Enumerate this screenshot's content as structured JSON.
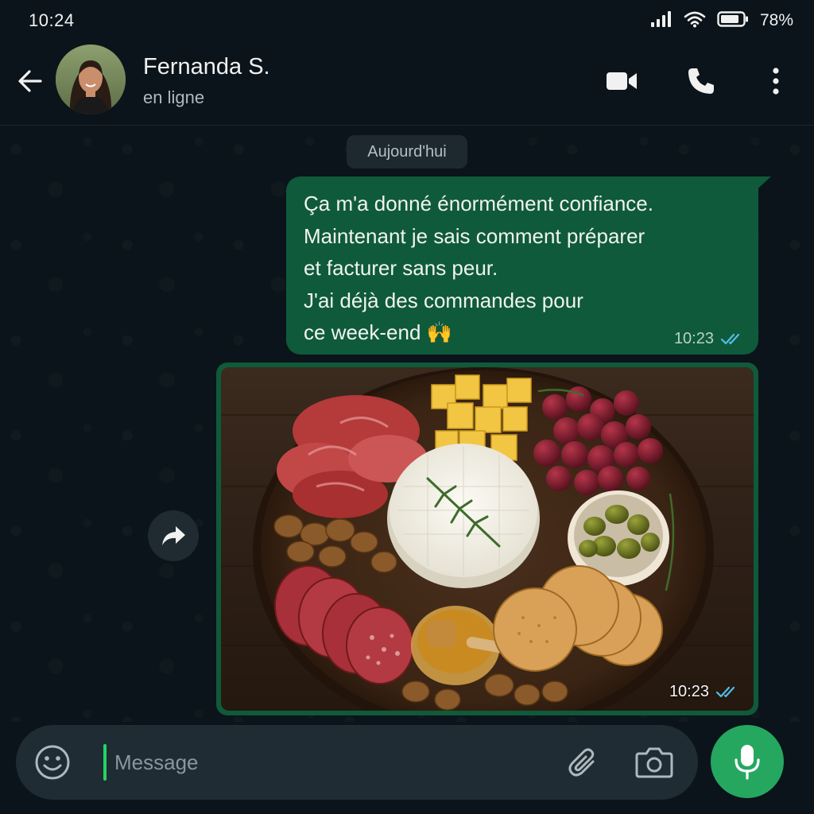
{
  "status_bar": {
    "time": "10:24",
    "battery": "78%",
    "icons": [
      "signal-icon",
      "wifi-icon",
      "battery-icon"
    ]
  },
  "header": {
    "contact_name": "Fernanda S.",
    "contact_status": "en ligne",
    "icons": [
      "back-arrow-icon",
      "video-call-icon",
      "phone-icon",
      "more-vertical-icon"
    ]
  },
  "chat": {
    "date_chip": "Aujourd'hui",
    "messages": [
      {
        "type": "text",
        "direction": "outgoing",
        "lines": [
          "Ça m'a donné énormément confiance.",
          "Maintenant je sais comment préparer",
          "et facturer sans peur.",
          "J'ai déjà des commandes pour",
          "ce week-end 🙌"
        ],
        "time": "10:23",
        "status": "read"
      },
      {
        "type": "image",
        "direction": "outgoing",
        "time": "10:23",
        "status": "read"
      }
    ],
    "forward_icon": "forward-icon"
  },
  "input_bar": {
    "placeholder": "Message",
    "value": "",
    "icons": [
      "emoji-icon",
      "attach-icon",
      "camera-icon",
      "microphone-icon"
    ]
  },
  "colors": {
    "background": "#0b141a",
    "outgoing_bubble": "#0f5a3a",
    "accent": "#25a760",
    "read_ticks": "#53bdeb",
    "input_bar": "#1f2c34"
  }
}
